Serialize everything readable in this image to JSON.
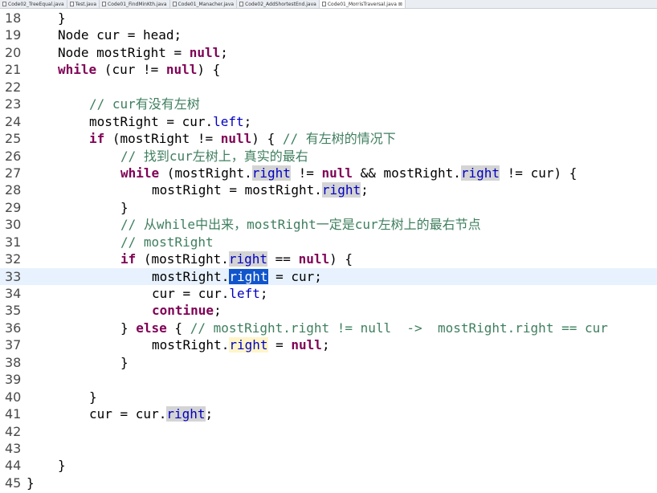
{
  "tabs": [
    {
      "label": "Code02_TreeEqual.java",
      "active": false
    },
    {
      "label": "Test.java",
      "active": false
    },
    {
      "label": "Code01_FindMinKth.java",
      "active": false
    },
    {
      "label": "Code01_Manacher.java",
      "active": false
    },
    {
      "label": "Code02_AddShortestEnd.java",
      "active": false
    },
    {
      "label": "Code01_MorrisTraversal.java",
      "active": true,
      "close": "⊠"
    }
  ],
  "code_lines": [
    {
      "n": "18",
      "t": [
        [
          "}",
          ""
        ]
      ],
      "indent": 2
    },
    {
      "n": "19",
      "t": [
        [
          "Node cur = head;",
          ""
        ]
      ],
      "indent": 2
    },
    {
      "n": "20",
      "t": [
        [
          "Node mostRight = ",
          ""
        ],
        [
          "null",
          "kw"
        ],
        [
          ";",
          ""
        ]
      ],
      "indent": 2
    },
    {
      "n": "21",
      "t": [
        [
          "while",
          "kw"
        ],
        [
          " (cur != ",
          ""
        ],
        [
          "null",
          "kw"
        ],
        [
          ") {",
          ""
        ]
      ],
      "indent": 2
    },
    {
      "n": "22",
      "t": [],
      "indent": 0
    },
    {
      "n": "23",
      "t": [
        [
          "// cur有没有左树",
          "cm"
        ]
      ],
      "indent": 3
    },
    {
      "n": "24",
      "t": [
        [
          "mostRight = cur.",
          ""
        ],
        [
          "left",
          "fld"
        ],
        [
          ";",
          ""
        ]
      ],
      "indent": 3
    },
    {
      "n": "25",
      "t": [
        [
          "if",
          "kw"
        ],
        [
          " (mostRight != ",
          ""
        ],
        [
          "null",
          "kw"
        ],
        [
          ") { ",
          ""
        ],
        [
          "// 有左树的情况下",
          "cm"
        ]
      ],
      "indent": 3
    },
    {
      "n": "26",
      "t": [
        [
          "// 找到cur左树上，真实的最右",
          "cm"
        ]
      ],
      "indent": 4
    },
    {
      "n": "27",
      "t": [
        [
          "while",
          "kw"
        ],
        [
          " (mostRight.",
          ""
        ],
        [
          "right",
          "fld occ"
        ],
        [
          " != ",
          ""
        ],
        [
          "null",
          "kw"
        ],
        [
          " && mostRight.",
          ""
        ],
        [
          "right",
          "fld occ"
        ],
        [
          " != cur) {",
          ""
        ]
      ],
      "indent": 4
    },
    {
      "n": "28",
      "t": [
        [
          "mostRight = mostRight.",
          ""
        ],
        [
          "right",
          "fld occ"
        ],
        [
          ";",
          ""
        ]
      ],
      "indent": 5
    },
    {
      "n": "29",
      "t": [
        [
          "}",
          ""
        ]
      ],
      "indent": 4
    },
    {
      "n": "30",
      "t": [
        [
          "// 从while中出来，mostRight一定是cur左树上的最右节点",
          "cm"
        ]
      ],
      "indent": 4
    },
    {
      "n": "31",
      "t": [
        [
          "// mostRight",
          "cm"
        ]
      ],
      "indent": 4
    },
    {
      "n": "32",
      "t": [
        [
          "if",
          "kw"
        ],
        [
          " (mostRight.",
          ""
        ],
        [
          "right",
          "fld occ"
        ],
        [
          " == ",
          ""
        ],
        [
          "null",
          "kw"
        ],
        [
          ") {",
          ""
        ]
      ],
      "indent": 4
    },
    {
      "n": "33",
      "t": [
        [
          "mostRight.",
          ""
        ],
        [
          "right",
          "sel"
        ],
        [
          " = cur;",
          ""
        ]
      ],
      "indent": 5,
      "current": true
    },
    {
      "n": "34",
      "t": [
        [
          "cur = cur.",
          ""
        ],
        [
          "left",
          "fld"
        ],
        [
          ";",
          ""
        ]
      ],
      "indent": 5
    },
    {
      "n": "35",
      "t": [
        [
          "continue",
          "kw"
        ],
        [
          ";",
          ""
        ]
      ],
      "indent": 5
    },
    {
      "n": "36",
      "t": [
        [
          "} ",
          ""
        ],
        [
          "else",
          "kw"
        ],
        [
          " { ",
          ""
        ],
        [
          "// mostRight.right != null  ->  mostRight.right == cur",
          "cm"
        ]
      ],
      "indent": 4
    },
    {
      "n": "37",
      "t": [
        [
          "mostRight.",
          ""
        ],
        [
          "right",
          "fld occw"
        ],
        [
          " = ",
          ""
        ],
        [
          "null",
          "kw"
        ],
        [
          ";",
          ""
        ]
      ],
      "indent": 5
    },
    {
      "n": "38",
      "t": [
        [
          "}",
          ""
        ]
      ],
      "indent": 4
    },
    {
      "n": "39",
      "t": [],
      "indent": 0
    },
    {
      "n": "40",
      "t": [
        [
          "}",
          ""
        ]
      ],
      "indent": 3
    },
    {
      "n": "41",
      "t": [
        [
          "cur = cur.",
          ""
        ],
        [
          "right",
          "fld occ"
        ],
        [
          ";",
          ""
        ]
      ],
      "indent": 3
    },
    {
      "n": "42",
      "t": [],
      "indent": 0
    },
    {
      "n": "43",
      "t": [],
      "indent": 0
    },
    {
      "n": "44",
      "t": [
        [
          "}",
          ""
        ]
      ],
      "indent": 2
    },
    {
      "n": "45",
      "t": [
        [
          "}",
          ""
        ]
      ],
      "indent": 1
    }
  ]
}
